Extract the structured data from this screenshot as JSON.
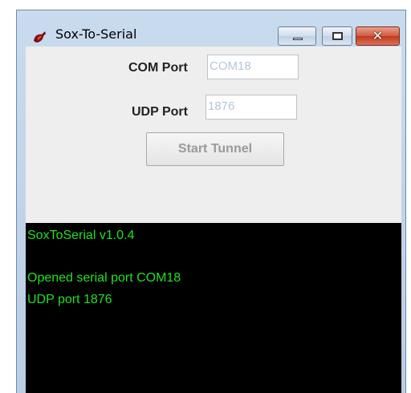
{
  "window": {
    "title": "Sox-To-Serial"
  },
  "form": {
    "com_port_label": "COM Port",
    "com_port_value": "COM18",
    "udp_port_label": "UDP Port",
    "udp_port_value": "1876",
    "start_button": "Start Tunnel"
  },
  "console": {
    "lines": [
      "SoxToSerial v1.0.4",
      "",
      "Opened serial port COM18",
      "UDP port 1876"
    ],
    "text_color": "#22e022",
    "background": "#000000"
  },
  "icons": [
    "app-icon",
    "minimize-icon",
    "maximize-icon",
    "close-icon"
  ]
}
